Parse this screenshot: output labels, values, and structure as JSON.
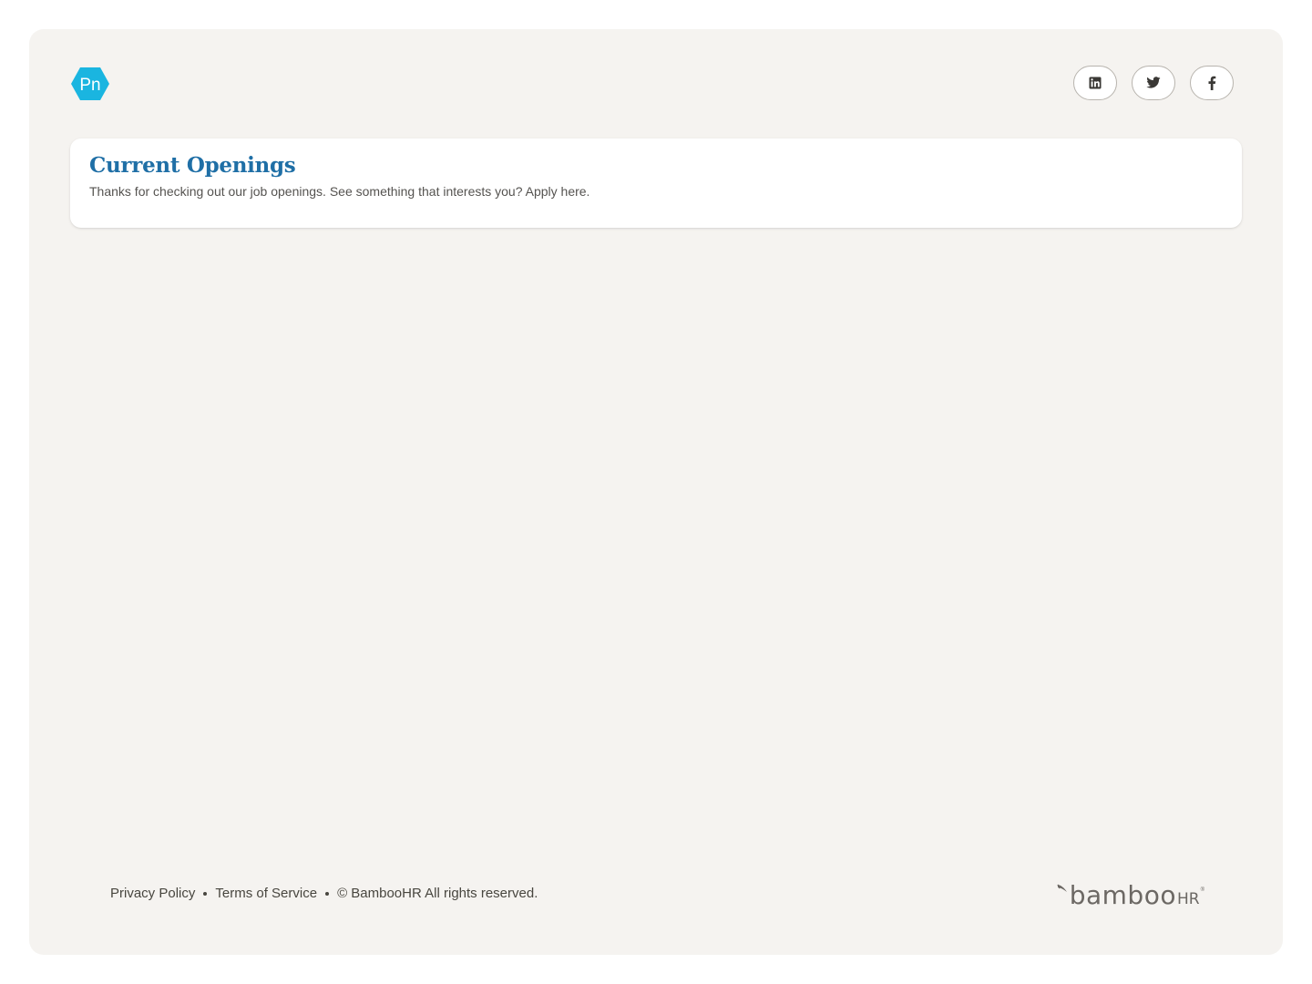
{
  "header": {
    "logo_text": "Pn",
    "logo_color": "#1ab5e0",
    "socials": [
      {
        "name": "linkedin",
        "icon": "linkedin-icon"
      },
      {
        "name": "twitter",
        "icon": "twitter-icon"
      },
      {
        "name": "facebook",
        "icon": "facebook-icon"
      }
    ]
  },
  "openings": {
    "title": "Current Openings",
    "subtitle": "Thanks for checking out our job openings. See something that interests you? Apply here."
  },
  "footer": {
    "privacy_label": "Privacy Policy",
    "terms_label": "Terms of Service",
    "copyright": "© BambooHR All rights reserved.",
    "brand_word": "bamboo",
    "brand_suffix": "HR",
    "brand_tm": "®"
  },
  "colors": {
    "accent": "#1f6fa6",
    "background": "#f5f3f0",
    "card": "#ffffff",
    "logo": "#1ab5e0"
  }
}
